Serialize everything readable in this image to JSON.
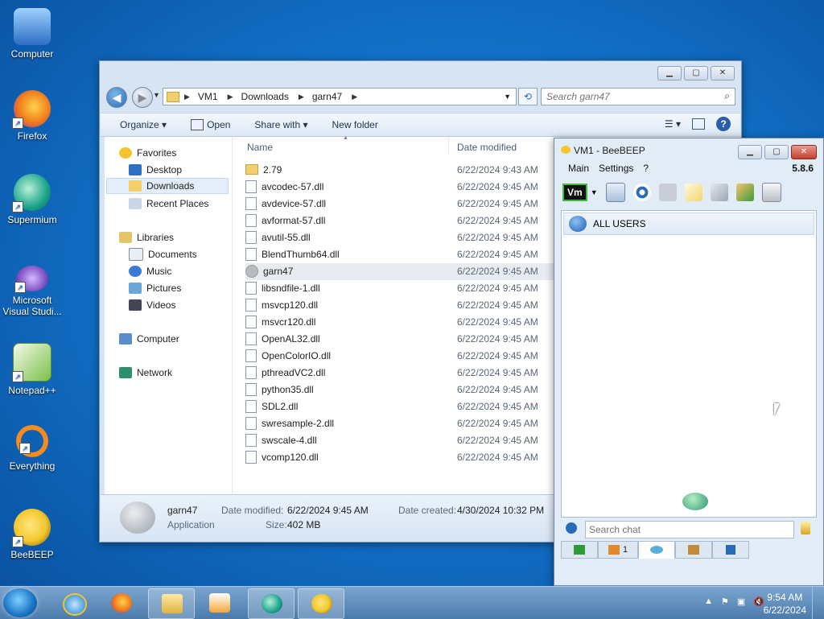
{
  "desktop": {
    "icons": [
      {
        "label": "Computer",
        "color": "#3a7bd5"
      },
      {
        "label": "Firefox",
        "color": "#f07a1a"
      },
      {
        "label": "Supermium",
        "color": "#1aa38a"
      },
      {
        "label": "Microsoft Visual Studio",
        "label_line1": "Microsoft",
        "label_line2": "Visual Studi...",
        "color": "#8659c7"
      },
      {
        "label": "Notepad++",
        "color": "#7cc04a"
      },
      {
        "label": "Everything",
        "color": "#f28c1e"
      },
      {
        "label": "BeeBEEP",
        "color": "#f3c72c"
      }
    ]
  },
  "explorer": {
    "address": [
      "VM1",
      "Downloads",
      "garn47"
    ],
    "search_placeholder": "Search garn47",
    "toolbar": {
      "organize": "Organize ▾",
      "open": "Open",
      "share_with": "Share with ▾",
      "new_folder": "New folder"
    },
    "nav": {
      "favorites": "Favorites",
      "desktop": "Desktop",
      "downloads": "Downloads",
      "recent": "Recent Places",
      "libraries": "Libraries",
      "documents": "Documents",
      "music": "Music",
      "pictures": "Pictures",
      "videos": "Videos",
      "computer": "Computer",
      "network": "Network"
    },
    "columns": {
      "name": "Name",
      "date": "Date modified"
    },
    "files": [
      {
        "name": "2.79",
        "date": "6/22/2024 9:43 AM",
        "kind": "folder"
      },
      {
        "name": "avcodec-57.dll",
        "date": "6/22/2024 9:45 AM",
        "kind": "dll"
      },
      {
        "name": "avdevice-57.dll",
        "date": "6/22/2024 9:45 AM",
        "kind": "dll"
      },
      {
        "name": "avformat-57.dll",
        "date": "6/22/2024 9:45 AM",
        "kind": "dll"
      },
      {
        "name": "avutil-55.dll",
        "date": "6/22/2024 9:45 AM",
        "kind": "dll"
      },
      {
        "name": "BlendThumb64.dll",
        "date": "6/22/2024 9:45 AM",
        "kind": "dll"
      },
      {
        "name": "garn47",
        "date": "6/22/2024 9:45 AM",
        "kind": "app"
      },
      {
        "name": "libsndfile-1.dll",
        "date": "6/22/2024 9:45 AM",
        "kind": "dll"
      },
      {
        "name": "msvcp120.dll",
        "date": "6/22/2024 9:45 AM",
        "kind": "dll"
      },
      {
        "name": "msvcr120.dll",
        "date": "6/22/2024 9:45 AM",
        "kind": "dll"
      },
      {
        "name": "OpenAL32.dll",
        "date": "6/22/2024 9:45 AM",
        "kind": "dll"
      },
      {
        "name": "OpenColorIO.dll",
        "date": "6/22/2024 9:45 AM",
        "kind": "dll"
      },
      {
        "name": "pthreadVC2.dll",
        "date": "6/22/2024 9:45 AM",
        "kind": "dll"
      },
      {
        "name": "python35.dll",
        "date": "6/22/2024 9:45 AM",
        "kind": "dll"
      },
      {
        "name": "SDL2.dll",
        "date": "6/22/2024 9:45 AM",
        "kind": "dll"
      },
      {
        "name": "swresample-2.dll",
        "date": "6/22/2024 9:45 AM",
        "kind": "dll"
      },
      {
        "name": "swscale-4.dll",
        "date": "6/22/2024 9:45 AM",
        "kind": "dll"
      },
      {
        "name": "vcomp120.dll",
        "date": "6/22/2024 9:45 AM",
        "kind": "dll"
      }
    ],
    "details": {
      "name": "garn47",
      "type": "Application",
      "modified_label": "Date modified:",
      "modified": "6/22/2024 9:45 AM",
      "created_label": "Date created:",
      "created": "4/30/2024 10:32 PM",
      "size_label": "Size:",
      "size": "402 MB"
    }
  },
  "beebeep": {
    "title": "VM1 - BeeBEEP",
    "menu": [
      "Main",
      "Settings",
      "?"
    ],
    "version": "5.8.6",
    "status_button": "Vm",
    "list_item": "ALL USERS",
    "search_placeholder": "Search chat",
    "tabs": [
      "",
      "1",
      "",
      "",
      ""
    ]
  },
  "taskbar": {
    "time": "9:54 AM",
    "date": "6/22/2024"
  }
}
